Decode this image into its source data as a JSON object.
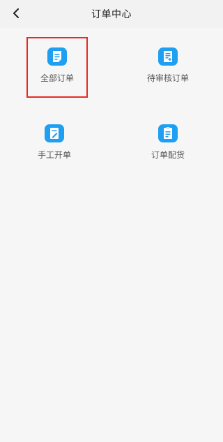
{
  "header": {
    "title": "订单中心",
    "back_icon": "chevron-left-icon"
  },
  "menu": {
    "items": [
      {
        "label": "全部订单",
        "icon": "document-icon"
      },
      {
        "label": "待审核订单",
        "icon": "document-review-icon"
      },
      {
        "label": "手工开单",
        "icon": "document-edit-icon"
      },
      {
        "label": "订单配货",
        "icon": "document-clip-icon"
      }
    ]
  },
  "colors": {
    "accent": "#1e9ff2",
    "highlight_box": "#e52a22",
    "background": "#f7f6f7",
    "header_background": "#f2f2f2"
  }
}
